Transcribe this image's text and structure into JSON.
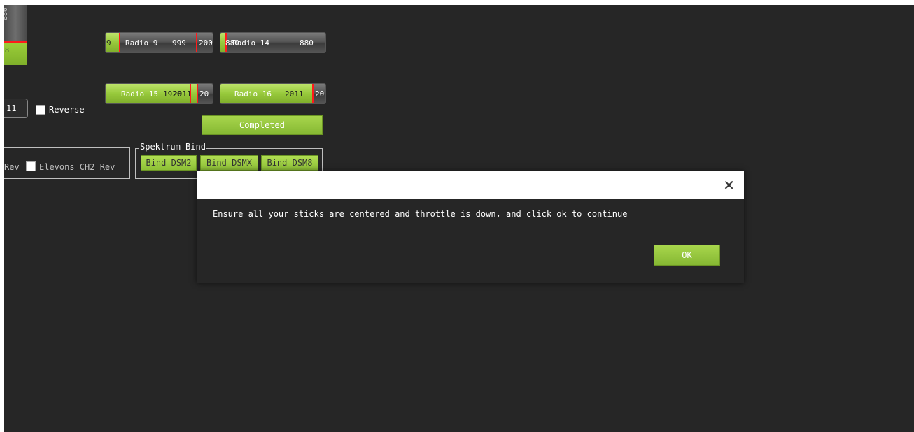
{
  "left_bar": {
    "top_value": "880",
    "bottom_value": "8"
  },
  "radios": [
    {
      "label": "Radio 9",
      "left_value": "9",
      "value": "999",
      "right_value": "200"
    },
    {
      "label": "Radio 14",
      "left_value": "880",
      "value": "880"
    },
    {
      "label": "Radio 15",
      "value": "1920",
      "overlay_value": "2011",
      "right_value": "20"
    },
    {
      "label": "Radio 16",
      "value": "2011",
      "overlay_value": "2011",
      "right_value": "20"
    }
  ],
  "reverse": {
    "field_value": "11",
    "label": "Reverse"
  },
  "completed_button": "Completed",
  "elevons": {
    "left_label": "Rev",
    "label": "Elevons CH2 Rev"
  },
  "spektrum": {
    "group_label": "Spektrum Bind",
    "buttons": [
      "Bind DSM2",
      "Bind DSMX",
      "Bind DSM8"
    ]
  },
  "dialog": {
    "close_glyph": "✕",
    "message": "Ensure all your sticks are centered and throttle is down, and click ok to continue",
    "ok_label": "OK"
  },
  "colors": {
    "background": "#262626",
    "accent_green": "#97c93b",
    "indicator_red": "#ff1b1b"
  }
}
